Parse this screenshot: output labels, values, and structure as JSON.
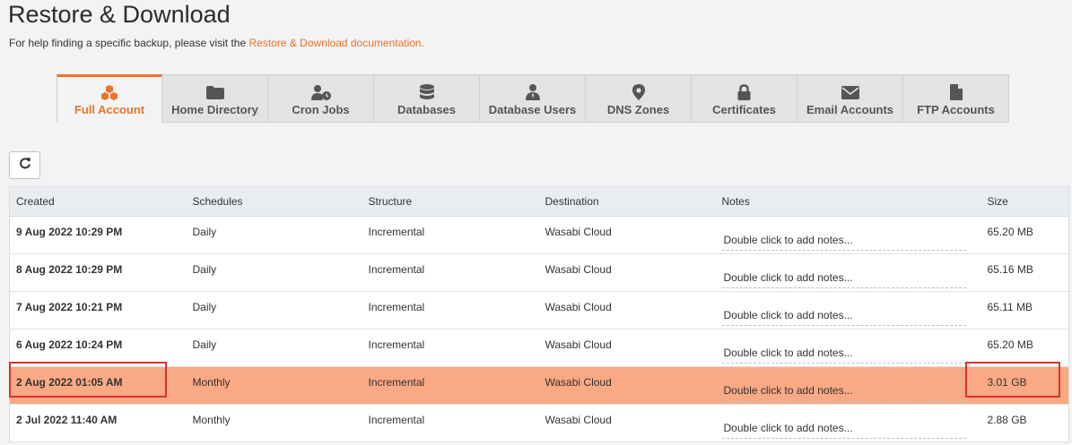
{
  "page": {
    "title": "Restore & Download",
    "help_prefix": "For help finding a specific backup, please visit the ",
    "help_link": "Restore & Download documentation."
  },
  "tabs": [
    {
      "label": "Full Account",
      "icon": "cubes-icon",
      "active": true
    },
    {
      "label": "Home Directory",
      "icon": "folder-icon"
    },
    {
      "label": "Cron Jobs",
      "icon": "user-clock-icon"
    },
    {
      "label": "Databases",
      "icon": "database-icon"
    },
    {
      "label": "Database Users",
      "icon": "user-tie-icon"
    },
    {
      "label": "DNS Zones",
      "icon": "map-marker-icon"
    },
    {
      "label": "Certificates",
      "icon": "lock-icon"
    },
    {
      "label": "Email Accounts",
      "icon": "envelope-icon"
    },
    {
      "label": "FTP Accounts",
      "icon": "file-icon"
    }
  ],
  "refresh_icon": "refresh-icon",
  "table": {
    "columns": [
      "Created",
      "Schedules",
      "Structure",
      "Destination",
      "Notes",
      "Size"
    ],
    "rows": [
      {
        "created": "9 Aug 2022 10:29 PM",
        "schedule": "Daily",
        "structure": "Incremental",
        "destination": "Wasabi Cloud",
        "notes": "Double click to add notes...",
        "size": "65.20 MB"
      },
      {
        "created": "8 Aug 2022 10:29 PM",
        "schedule": "Daily",
        "structure": "Incremental",
        "destination": "Wasabi Cloud",
        "notes": "Double click to add notes...",
        "size": "65.16 MB"
      },
      {
        "created": "7 Aug 2022 10:21 PM",
        "schedule": "Daily",
        "structure": "Incremental",
        "destination": "Wasabi Cloud",
        "notes": "Double click to add notes...",
        "size": "65.11 MB"
      },
      {
        "created": "6 Aug 2022 10:24 PM",
        "schedule": "Daily",
        "structure": "Incremental",
        "destination": "Wasabi Cloud",
        "notes": "Double click to add notes...",
        "size": "65.20 MB"
      },
      {
        "created": "2 Aug 2022 01:05 AM",
        "schedule": "Monthly",
        "structure": "Incremental",
        "destination": "Wasabi Cloud",
        "notes": "Double click to add notes...",
        "size": "3.01 GB",
        "highlight": true
      },
      {
        "created": "2 Jul 2022 11:40 AM",
        "schedule": "Monthly",
        "structure": "Incremental",
        "destination": "Wasabi Cloud",
        "notes": "Double click to add notes...",
        "size": "2.88 GB"
      }
    ]
  },
  "colors": {
    "accent": "#e8732a",
    "highlight_row": "#f9a984",
    "annotation": "#e0302a"
  }
}
